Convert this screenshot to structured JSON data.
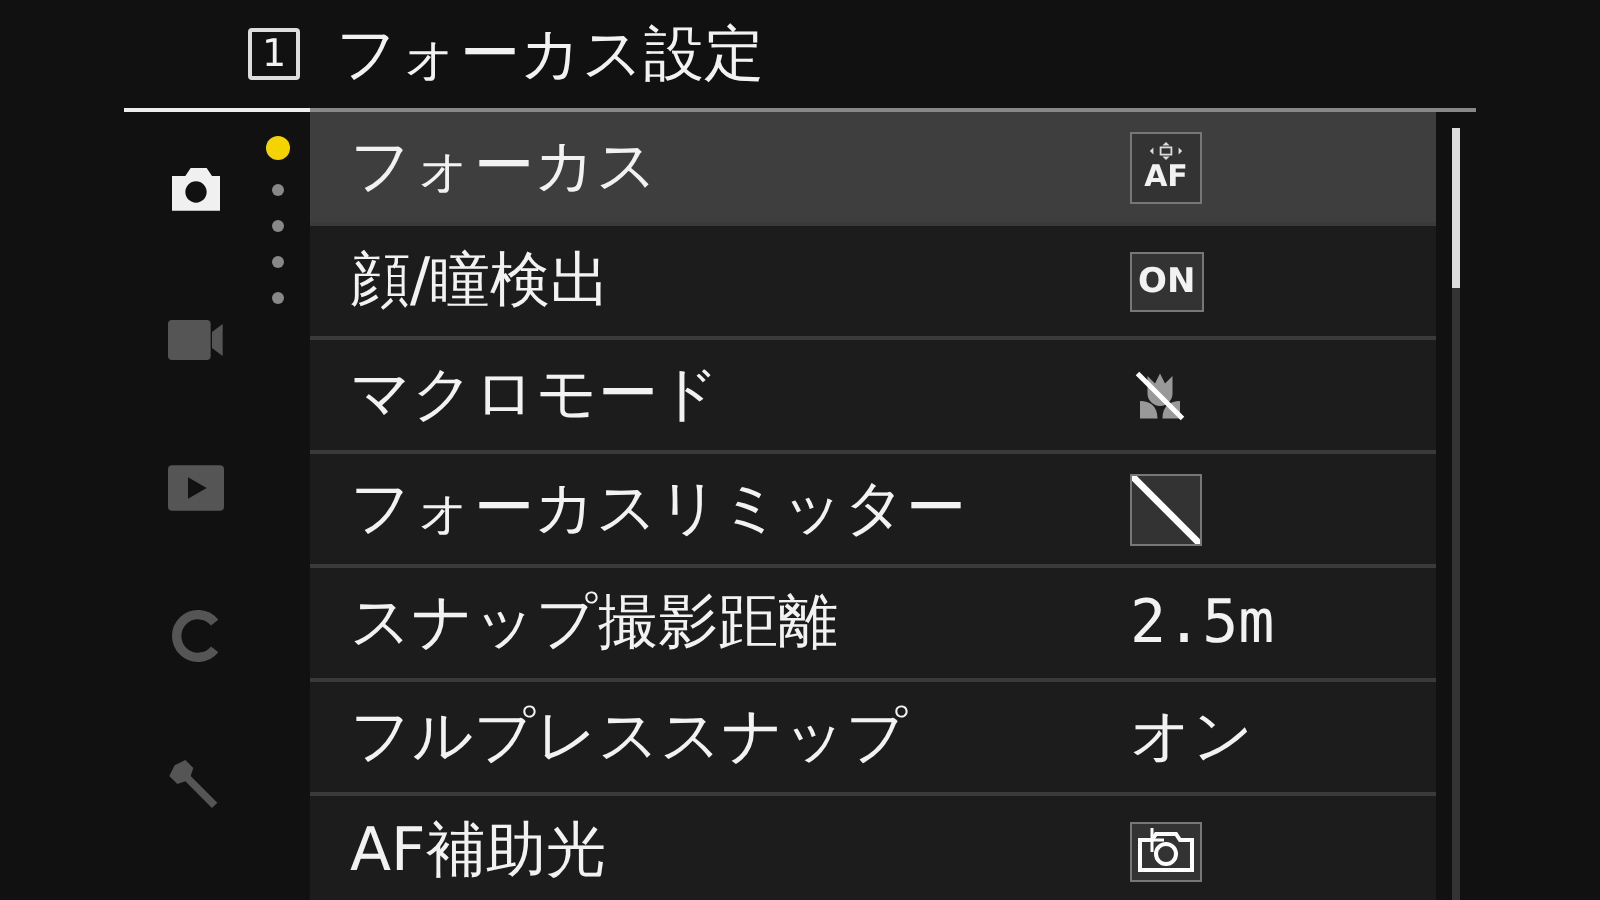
{
  "header": {
    "page_number": "1",
    "title": "フォーカス設定"
  },
  "sidebar": {
    "tabs": [
      {
        "kind": "camera",
        "selected": true
      },
      {
        "kind": "video",
        "selected": false
      },
      {
        "kind": "play",
        "selected": false
      },
      {
        "kind": "custom",
        "selected": false
      },
      {
        "kind": "wrench",
        "selected": false
      }
    ],
    "pages": [
      {
        "selected": true
      },
      {
        "selected": false
      },
      {
        "selected": false
      },
      {
        "selected": false
      },
      {
        "selected": false
      }
    ]
  },
  "menu": {
    "items": [
      {
        "label": "フォーカス",
        "selected": true,
        "value": {
          "kind": "af",
          "text": "AF"
        }
      },
      {
        "label": "顔/瞳検出",
        "selected": false,
        "value": {
          "kind": "badge",
          "text": "ON"
        }
      },
      {
        "label": "マクロモード",
        "selected": false,
        "value": {
          "kind": "macro-off"
        }
      },
      {
        "label": "フォーカスリミッター",
        "selected": false,
        "value": {
          "kind": "limit-off"
        }
      },
      {
        "label": "スナップ撮影距離",
        "selected": false,
        "value": {
          "kind": "text",
          "text": "2.5m"
        }
      },
      {
        "label": "フルプレススナップ",
        "selected": false,
        "value": {
          "kind": "text",
          "text": "オン"
        }
      },
      {
        "label": "AF補助光",
        "selected": false,
        "value": {
          "kind": "assist-light"
        }
      }
    ]
  }
}
